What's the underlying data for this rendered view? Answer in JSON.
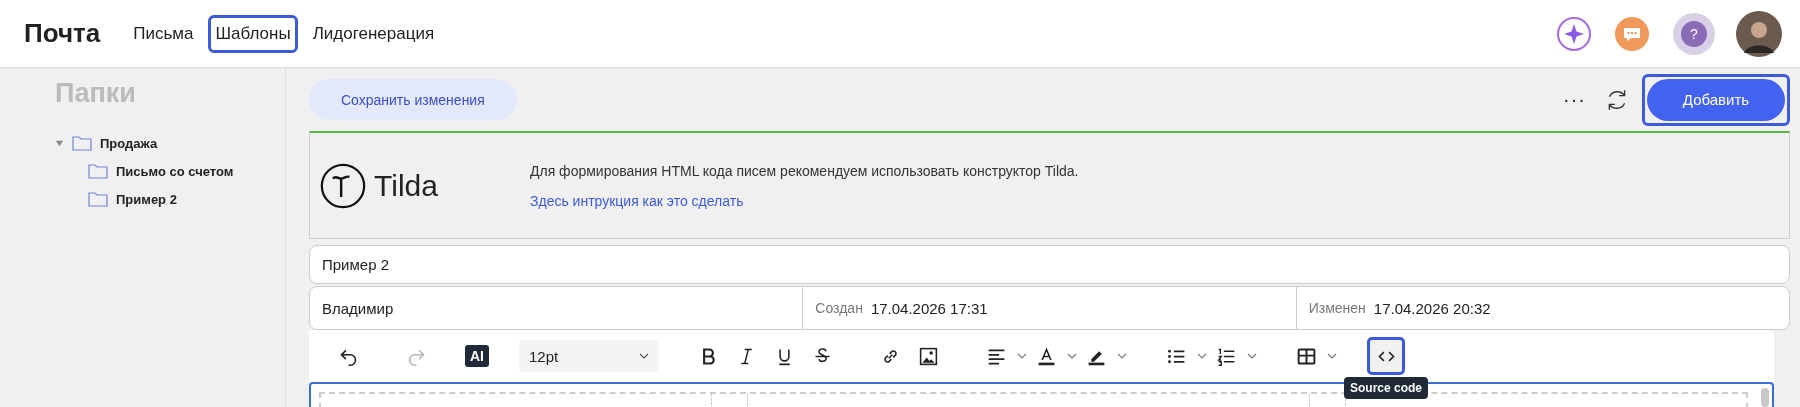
{
  "header": {
    "logo": "Почта",
    "help": "?",
    "tabs": [
      {
        "label": "Письма",
        "highlighted": false
      },
      {
        "label": "Шаблоны",
        "highlighted": true
      },
      {
        "label": "Лидогенерация",
        "highlighted": false
      }
    ]
  },
  "sidebar": {
    "title": "Папки",
    "tree": [
      {
        "label": "Продажа",
        "expanded": true,
        "children": [
          {
            "label": "Письмо со счетом"
          },
          {
            "label": "Пример 2"
          }
        ]
      }
    ]
  },
  "actions": {
    "save": "Сохранить изменения",
    "more": "···",
    "add": {
      "label": "Добавить",
      "highlighted": true
    }
  },
  "banner": {
    "brand": "Tilda",
    "text": "Для формирования HTML кода писем рекомендуем использовать конструктор Tilda.",
    "link": "Здесь интрукция как это сделать"
  },
  "template": {
    "name": "Пример 2",
    "author": "Владимир",
    "created_label": "Создан",
    "created": "17.04.2026 17:31",
    "modified_label": "Изменен",
    "modified": "17.04.2026 20:32"
  },
  "toolbar": [
    {
      "kind": "button",
      "disabled": false,
      "highlighted": false
    },
    {
      "kind": "button",
      "disabled": true,
      "highlighted": false
    },
    {
      "kind": "badge",
      "label": "AI"
    },
    {
      "kind": "select",
      "value": "12pt"
    },
    {
      "kind": "button",
      "disabled": false,
      "highlighted": false
    },
    {
      "kind": "button",
      "disabled": false,
      "highlighted": false
    },
    {
      "kind": "button",
      "disabled": false,
      "highlighted": false
    },
    {
      "kind": "button",
      "disabled": false,
      "highlighted": false
    },
    {
      "kind": "button",
      "disabled": false,
      "highlighted": false
    },
    {
      "kind": "button",
      "disabled": false,
      "highlighted": false
    },
    {
      "kind": "dropdown",
      "disabled": false,
      "highlighted": false
    },
    {
      "kind": "dropdown",
      "disabled": false,
      "highlighted": false
    },
    {
      "kind": "dropdown",
      "disabled": false,
      "highlighted": false
    },
    {
      "kind": "dropdown",
      "disabled": false,
      "highlighted": false
    },
    {
      "kind": "dropdown",
      "disabled": false,
      "highlighted": false
    },
    {
      "kind": "dropdown",
      "disabled": false,
      "highlighted": false
    },
    {
      "kind": "button",
      "disabled": false,
      "highlighted": true,
      "tooltip": "Source code"
    }
  ]
}
